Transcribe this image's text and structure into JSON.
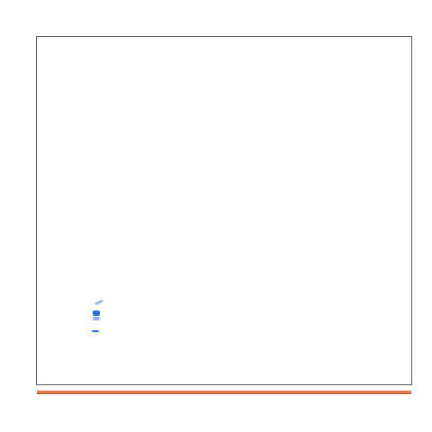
{
  "scene": {
    "background_color": "#ffffff",
    "frame_border_color": "#5a5a5a",
    "bottom_strip_color": "#e07a4e",
    "bottom_strip_shadow_color": "#b4542f",
    "blue_mark_color": "#2f6ce6",
    "blue_mark_light_color": "#8fb2f5"
  }
}
